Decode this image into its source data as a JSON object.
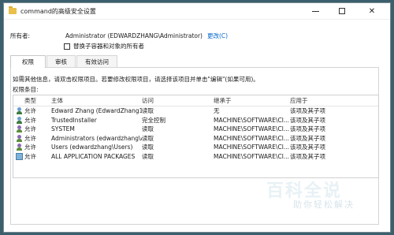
{
  "window": {
    "title": "command的高级安全设置"
  },
  "owner": {
    "label": "所有者:",
    "value": "Administrator (EDWARDZHANG\\Administrator)",
    "change_link": "更改(C)"
  },
  "replace_owner_checkbox": {
    "label": "替换子容器和对象的所有者",
    "checked": false
  },
  "tabs": [
    {
      "label": "权限",
      "active": true
    },
    {
      "label": "审核",
      "active": false
    },
    {
      "label": "有效访问",
      "active": false
    }
  ],
  "info_text": "如需其他信息，请双击权限项目。若要修改权限项目，请选择该项目并单击\"编辑\"(如果可用)。",
  "entries_label": "权限条目:",
  "grid": {
    "headers": {
      "type": "类型",
      "principal": "主体",
      "access": "访问",
      "inherited": "继承于",
      "applies": "应用于"
    },
    "rows": [
      {
        "icon": "user-icon",
        "type": "允许",
        "principal": "Edward Zhang (EdwardZhang12...",
        "access": "读取",
        "inherited": "无",
        "applies": "该项及其子项"
      },
      {
        "icon": "user-icon",
        "type": "允许",
        "principal": "TrustedInstaller",
        "access": "完全控制",
        "inherited": "MACHINE\\SOFTWARE\\Cl...",
        "applies": "该项及其子项"
      },
      {
        "icon": "group-icon",
        "type": "允许",
        "principal": "SYSTEM",
        "access": "读取",
        "inherited": "MACHINE\\SOFTWARE\\Cl...",
        "applies": "该项及其子项"
      },
      {
        "icon": "group-icon",
        "type": "允许",
        "principal": "Administrators (edwardzhang\\A...",
        "access": "读取",
        "inherited": "MACHINE\\SOFTWARE\\Cl...",
        "applies": "该项及其子项"
      },
      {
        "icon": "group-icon",
        "type": "允许",
        "principal": "Users (edwardzhang\\Users)",
        "access": "读取",
        "inherited": "MACHINE\\SOFTWARE\\Cl...",
        "applies": "该项及其子项"
      },
      {
        "icon": "package-icon",
        "type": "允许",
        "principal": "ALL APPLICATION PACKAGES",
        "access": "读取",
        "inherited": "MACHINE\\SOFTWARE\\Cl...",
        "applies": "该项及其子项"
      }
    ]
  },
  "watermark": {
    "title": "百科全说",
    "subtitle": "助你轻松解决"
  }
}
